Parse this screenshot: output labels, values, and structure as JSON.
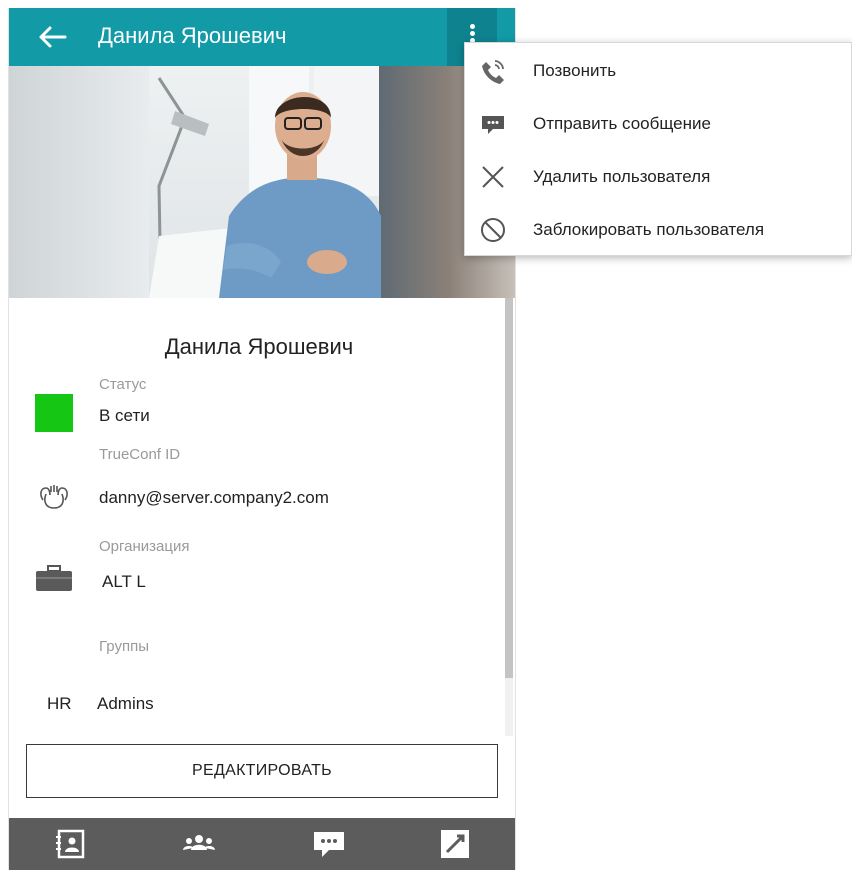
{
  "header": {
    "title": "Данила Ярошевич"
  },
  "profile": {
    "name": "Данила Ярошевич",
    "status_label": "Статус",
    "status_value": "В сети",
    "status_color": "#15c615",
    "id_label": "TrueConf ID",
    "id_value": "danny@server.company2.com",
    "org_label": "Организация",
    "org_value": "ALT L",
    "groups_label": "Группы",
    "group_prefix": "HR",
    "group_value": "Admins"
  },
  "edit_button": "РЕДАКТИРОВАТЬ",
  "menu": {
    "items": [
      {
        "label": "Позвонить",
        "icon": "phone-icon"
      },
      {
        "label": "Отправить сообщение",
        "icon": "chat-icon"
      },
      {
        "label": "Удалить пользователя",
        "icon": "close-icon"
      },
      {
        "label": "Заблокировать пользователя",
        "icon": "block-icon"
      }
    ]
  },
  "bottom_nav": [
    "contacts-icon",
    "group-icon",
    "chat-icon",
    "call-history-icon"
  ],
  "colors": {
    "accent": "#129aa7",
    "accent_dark": "#0e838f",
    "bottom_bar": "#5c5c5c"
  }
}
